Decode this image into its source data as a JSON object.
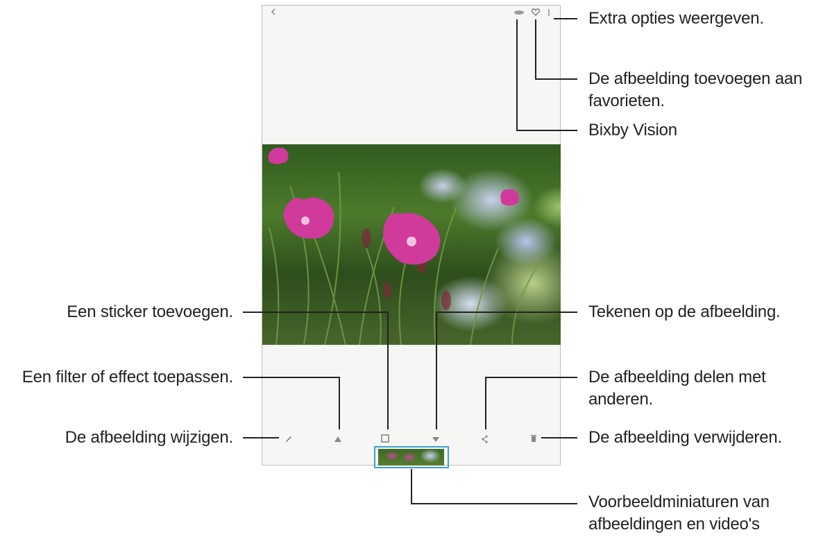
{
  "callouts": {
    "extra_options": "Extra opties weergeven.",
    "favorites_line1": "De afbeelding toevoegen aan",
    "favorites_line2": "favorieten.",
    "bixby": "Bixby Vision",
    "sticker": "Een sticker toevoegen.",
    "draw": "Tekenen op de afbeelding.",
    "filter": "Een filter of effect toepassen.",
    "share_line1": "De afbeelding delen met",
    "share_line2": "anderen.",
    "edit": "De afbeelding wijzigen.",
    "delete": "De afbeelding verwijderen.",
    "thumbs_line1": "Voorbeeldminiaturen van",
    "thumbs_line2": "afbeeldingen en video's"
  },
  "colors": {
    "highlight_border": "#3ea0d8",
    "flower": "#d03a9b",
    "leader_line": "#222222"
  },
  "icons": {
    "back": "back-icon",
    "bixby": "bixby-vision-icon",
    "favorite": "heart-icon",
    "more": "more-options-icon",
    "edit": "pencil-icon",
    "filter": "filter-icon",
    "sticker": "sticker-icon",
    "draw": "brush-icon",
    "share": "share-icon",
    "delete": "trash-icon"
  }
}
